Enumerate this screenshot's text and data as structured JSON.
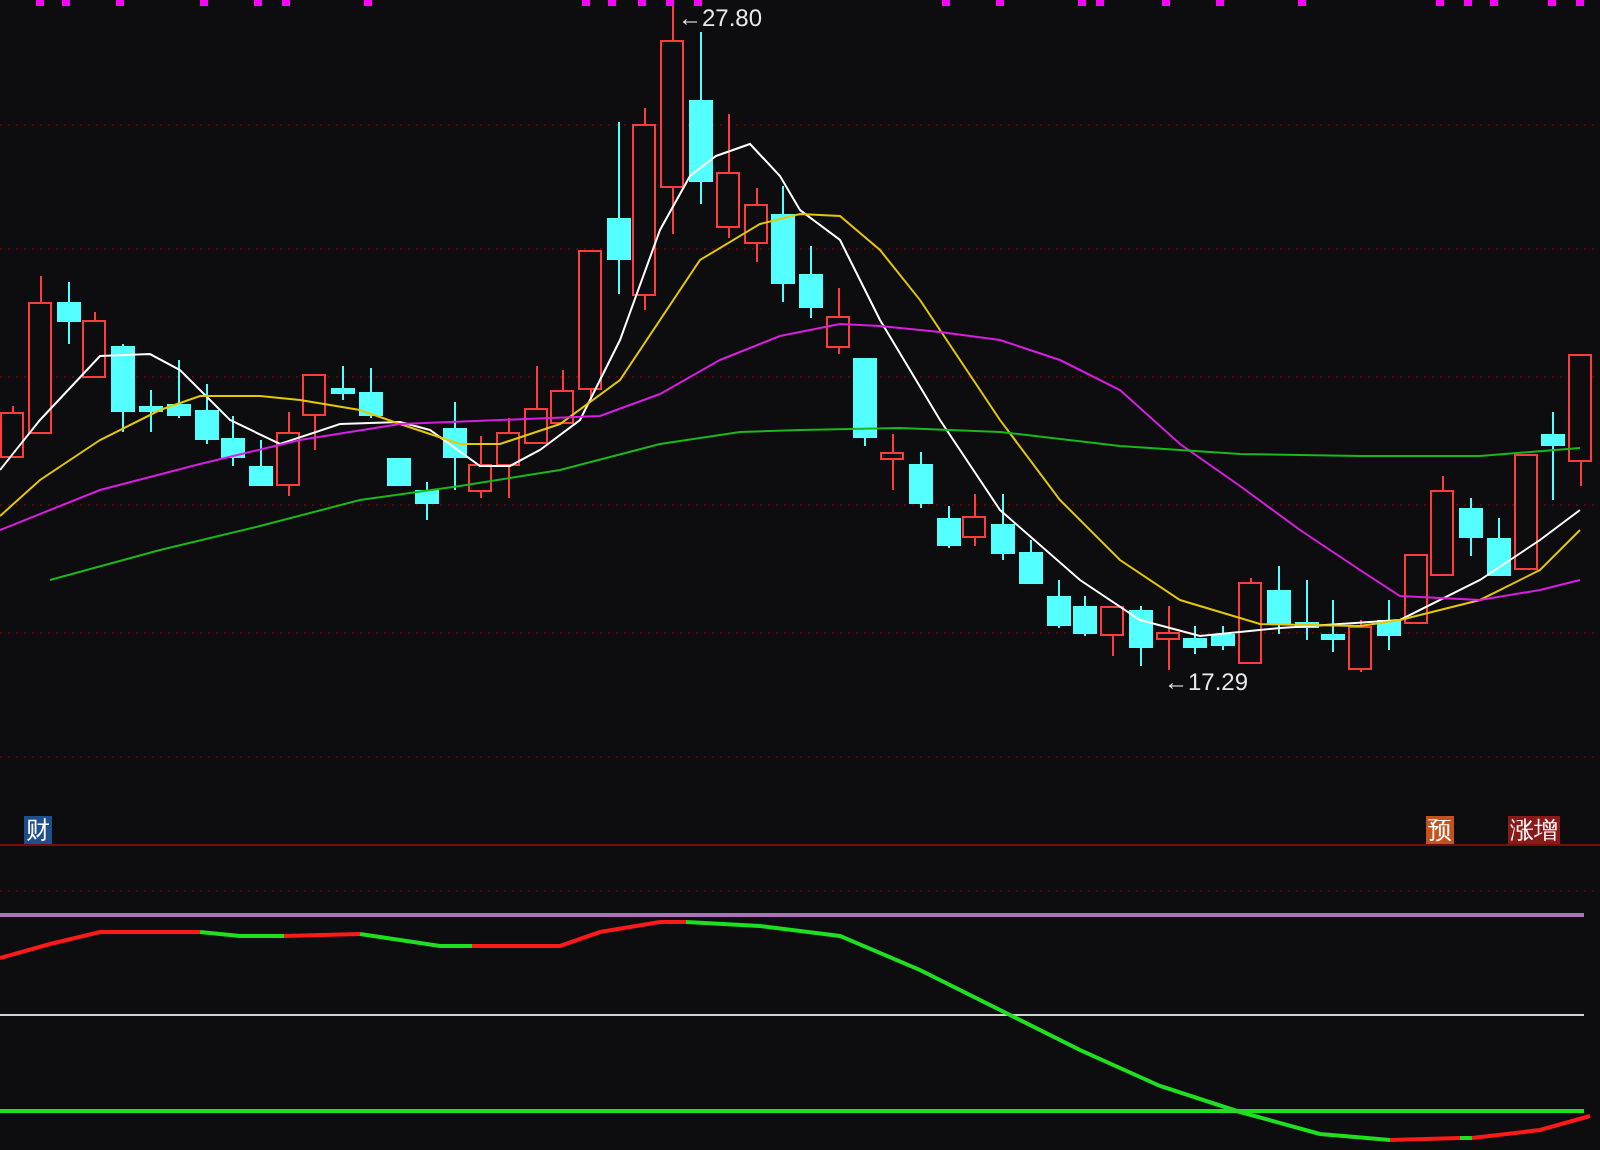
{
  "price_labels": [
    {
      "text": "←27.80",
      "kind": "high"
    },
    {
      "text": "←17.29",
      "kind": "low"
    }
  ],
  "badges": [
    {
      "text": "财",
      "color": "#1f4e8c"
    },
    {
      "text": "预",
      "color": "#c4521c"
    },
    {
      "text": "涨增",
      "color": "#8a1a1a"
    }
  ]
}
